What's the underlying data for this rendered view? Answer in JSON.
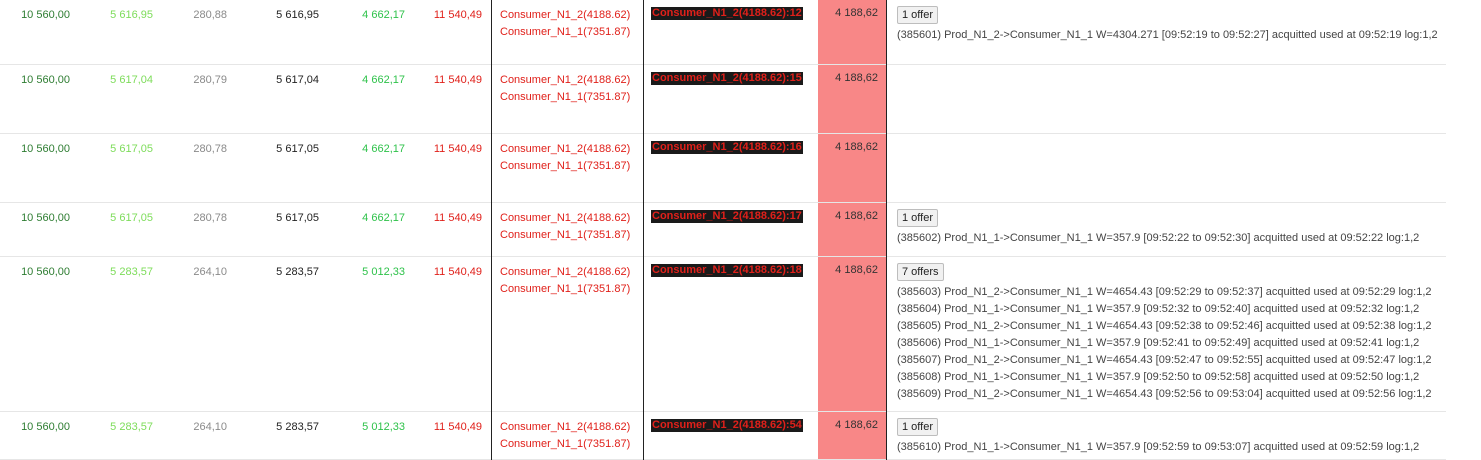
{
  "rows": [
    {
      "col1": "10 560,00",
      "col2": "5 616,95",
      "col3": "280,88",
      "col4": "5 616,95",
      "col5": "4 662,17",
      "col6": "11 540,49",
      "consumers": [
        "Consumer_N1_2(4188.62)",
        "Consumer_N1_1(7351.87)"
      ],
      "badge": "Consumer_N1_2(4188.62):12",
      "highlight": "4 188,62",
      "offer_button": "1 offer",
      "offers": [
        "(385601) Prod_N1_2->Consumer_N1_1 W=4304.271 [09:52:19 to 09:52:27] acquitted used at 09:52:19 log:1,2"
      ]
    },
    {
      "col1": "10 560,00",
      "col2": "5 617,04",
      "col3": "280,79",
      "col4": "5 617,04",
      "col5": "4 662,17",
      "col6": "11 540,49",
      "consumers": [
        "Consumer_N1_2(4188.62)",
        "Consumer_N1_1(7351.87)"
      ],
      "badge": "Consumer_N1_2(4188.62):15",
      "highlight": "4 188,62",
      "offer_button": "",
      "offers": []
    },
    {
      "col1": "10 560,00",
      "col2": "5 617,05",
      "col3": "280,78",
      "col4": "5 617,05",
      "col5": "4 662,17",
      "col6": "11 540,49",
      "consumers": [
        "Consumer_N1_2(4188.62)",
        "Consumer_N1_1(7351.87)"
      ],
      "badge": "Consumer_N1_2(4188.62):16",
      "highlight": "4 188,62",
      "offer_button": "",
      "offers": []
    },
    {
      "col1": "10 560,00",
      "col2": "5 617,05",
      "col3": "280,78",
      "col4": "5 617,05",
      "col5": "4 662,17",
      "col6": "11 540,49",
      "consumers": [
        "Consumer_N1_2(4188.62)",
        "Consumer_N1_1(7351.87)"
      ],
      "badge": "Consumer_N1_2(4188.62):17",
      "highlight": "4 188,62",
      "offer_button": "1 offer",
      "offers": [
        "(385602) Prod_N1_1->Consumer_N1_1 W=357.9 [09:52:22 to 09:52:30] acquitted used at 09:52:22 log:1,2"
      ]
    },
    {
      "col1": "10 560,00",
      "col2": "5 283,57",
      "col3": "264,10",
      "col4": "5 283,57",
      "col5": "5 012,33",
      "col6": "11 540,49",
      "consumers": [
        "Consumer_N1_2(4188.62)",
        "Consumer_N1_1(7351.87)"
      ],
      "badge": "Consumer_N1_2(4188.62):18",
      "highlight": "4 188,62",
      "offer_button": "7 offers",
      "offers": [
        "(385603) Prod_N1_2->Consumer_N1_1 W=4654.43 [09:52:29 to 09:52:37] acquitted used at 09:52:29 log:1,2",
        "(385604) Prod_N1_1->Consumer_N1_1 W=357.9 [09:52:32 to 09:52:40] acquitted used at 09:52:32 log:1,2",
        "(385605) Prod_N1_2->Consumer_N1_1 W=4654.43 [09:52:38 to 09:52:46] acquitted used at 09:52:38 log:1,2",
        "(385606) Prod_N1_1->Consumer_N1_1 W=357.9 [09:52:41 to 09:52:49] acquitted used at 09:52:41 log:1,2",
        "(385607) Prod_N1_2->Consumer_N1_1 W=4654.43 [09:52:47 to 09:52:55] acquitted used at 09:52:47 log:1,2",
        "(385608) Prod_N1_1->Consumer_N1_1 W=357.9 [09:52:50 to 09:52:58] acquitted used at 09:52:50 log:1,2",
        "(385609) Prod_N1_2->Consumer_N1_1 W=4654.43 [09:52:56 to 09:53:04] acquitted used at 09:52:56 log:1,2"
      ]
    },
    {
      "col1": "10 560,00",
      "col2": "5 283,57",
      "col3": "264,10",
      "col4": "5 283,57",
      "col5": "5 012,33",
      "col6": "11 540,49",
      "consumers": [
        "Consumer_N1_2(4188.62)",
        "Consumer_N1_1(7351.87)"
      ],
      "badge": "Consumer_N1_2(4188.62):54",
      "highlight": "4 188,62",
      "offer_button": "1 offer",
      "offers": [
        "(385610) Prod_N1_1->Consumer_N1_1 W=357.9 [09:52:59 to 09:53:07] acquitted used at 09:52:59 log:1,2"
      ]
    }
  ]
}
